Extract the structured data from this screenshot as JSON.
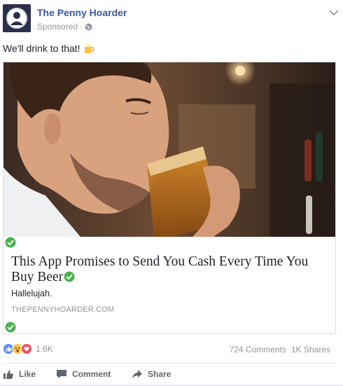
{
  "header": {
    "page_name": "The Penny Hoarder",
    "sponsored": "Sponsored",
    "separator": "·"
  },
  "post": {
    "text": "We'll drink to that!"
  },
  "link": {
    "headline": "This App Promises to Send You Cash Every Time You Buy Beer",
    "subtitle": "Hallelujah.",
    "domain": "THEPENNYHOARDER.COM"
  },
  "engagement": {
    "reaction_count": "1.6K",
    "comments": "724 Comments",
    "shares": "1K Shares",
    "reactions": [
      "like-reaction",
      "wow-reaction",
      "love-reaction"
    ]
  },
  "actions": {
    "like": "Like",
    "comment": "Comment",
    "share": "Share"
  },
  "colors": {
    "brand_link": "#365899",
    "meta_gray": "#90949c",
    "verified_green": "#4caf50"
  }
}
